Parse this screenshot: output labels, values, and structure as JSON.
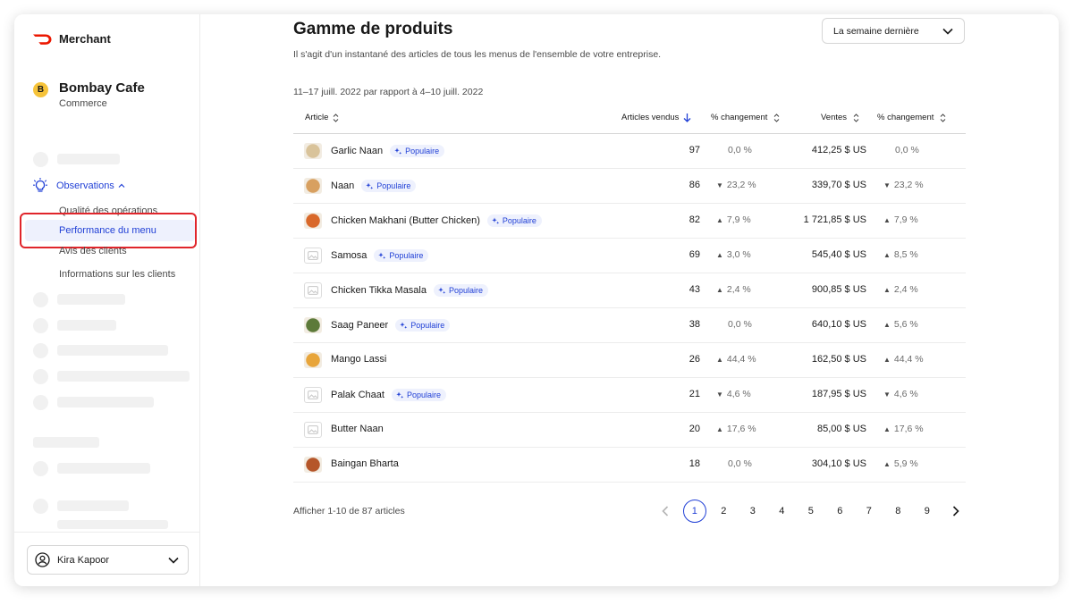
{
  "brand": {
    "name": "Merchant",
    "color": "#eb1700"
  },
  "store": {
    "initial": "B",
    "name": "Bombay Cafe",
    "type": "Commerce"
  },
  "nav": {
    "observations_label": "Observations",
    "sub_items": [
      "Qualité des opérations",
      "Performance du menu",
      "Avis des clients",
      "Informations sur les clients"
    ],
    "active_item": "Performance du menu"
  },
  "user": {
    "name": "Kira Kapoor"
  },
  "header": {
    "title": "Gamme de produits",
    "subtitle": "Il s'agit d'un instantané des articles de tous les menus de l'ensemble de votre entreprise.",
    "period_label": "La semaine dernière",
    "date_range": "11–17 juill. 2022 par rapport à 4–10 juill. 2022"
  },
  "table": {
    "columns": [
      "Article",
      "Articles vendus",
      "% changement",
      "Ventes",
      "% changement"
    ],
    "popular_label": "Populaire",
    "rows": [
      {
        "name": "Garlic Naan",
        "popular": true,
        "sold": "97",
        "sold_change": "0,0 %",
        "sold_dir": "none",
        "sales": "412,25 $ US",
        "sales_change": "0,0 %",
        "sales_dir": "none",
        "thumb": "photo",
        "thumb_color": "#d9c39a"
      },
      {
        "name": "Naan",
        "popular": true,
        "sold": "86",
        "sold_change": "23,2 %",
        "sold_dir": "down",
        "sales": "339,70 $ US",
        "sales_change": "23,2 %",
        "sales_dir": "down",
        "thumb": "photo",
        "thumb_color": "#d8a060"
      },
      {
        "name": "Chicken Makhani (Butter Chicken)",
        "popular": true,
        "sold": "82",
        "sold_change": "7,9 %",
        "sold_dir": "up",
        "sales": "1 721,85 $ US",
        "sales_change": "7,9 %",
        "sales_dir": "up",
        "thumb": "photo",
        "thumb_color": "#d9682a"
      },
      {
        "name": "Samosa",
        "popular": true,
        "sold": "69",
        "sold_change": "3,0 %",
        "sold_dir": "up",
        "sales": "545,40 $ US",
        "sales_change": "8,5 %",
        "sales_dir": "up",
        "thumb": "placeholder",
        "thumb_color": "#ffffff"
      },
      {
        "name": "Chicken Tikka Masala",
        "popular": true,
        "sold": "43",
        "sold_change": "2,4 %",
        "sold_dir": "up",
        "sales": "900,85 $ US",
        "sales_change": "2,4 %",
        "sales_dir": "up",
        "thumb": "placeholder",
        "thumb_color": "#ffffff"
      },
      {
        "name": "Saag Paneer",
        "popular": true,
        "sold": "38",
        "sold_change": "0,0 %",
        "sold_dir": "none",
        "sales": "640,10 $ US",
        "sales_change": "5,6 %",
        "sales_dir": "up",
        "thumb": "photo",
        "thumb_color": "#5d7a3a"
      },
      {
        "name": "Mango Lassi",
        "popular": false,
        "sold": "26",
        "sold_change": "44,4 %",
        "sold_dir": "up",
        "sales": "162,50 $ US",
        "sales_change": "44,4 %",
        "sales_dir": "up",
        "thumb": "photo",
        "thumb_color": "#e8a53a"
      },
      {
        "name": "Palak Chaat",
        "popular": true,
        "sold": "21",
        "sold_change": "4,6 %",
        "sold_dir": "down",
        "sales": "187,95 $ US",
        "sales_change": "4,6 %",
        "sales_dir": "down",
        "thumb": "placeholder",
        "thumb_color": "#ffffff"
      },
      {
        "name": "Butter Naan",
        "popular": false,
        "sold": "20",
        "sold_change": "17,6 %",
        "sold_dir": "up",
        "sales": "85,00 $ US",
        "sales_change": "17,6 %",
        "sales_dir": "up",
        "thumb": "placeholder",
        "thumb_color": "#ffffff"
      },
      {
        "name": "Baingan Bharta",
        "popular": false,
        "sold": "18",
        "sold_change": "0,0 %",
        "sold_dir": "none",
        "sales": "304,10 $ US",
        "sales_change": "5,9 %",
        "sales_dir": "up",
        "thumb": "photo",
        "thumb_color": "#b5562a"
      }
    ]
  },
  "footer": {
    "count_text": "Afficher 1-10 de 87 articles",
    "pages": [
      "1",
      "2",
      "3",
      "4",
      "5",
      "6",
      "7",
      "8",
      "9"
    ],
    "current_page": "1"
  },
  "colors": {
    "accent": "#2140d6",
    "highlight": "#e0252b",
    "brand": "#eb1700"
  }
}
